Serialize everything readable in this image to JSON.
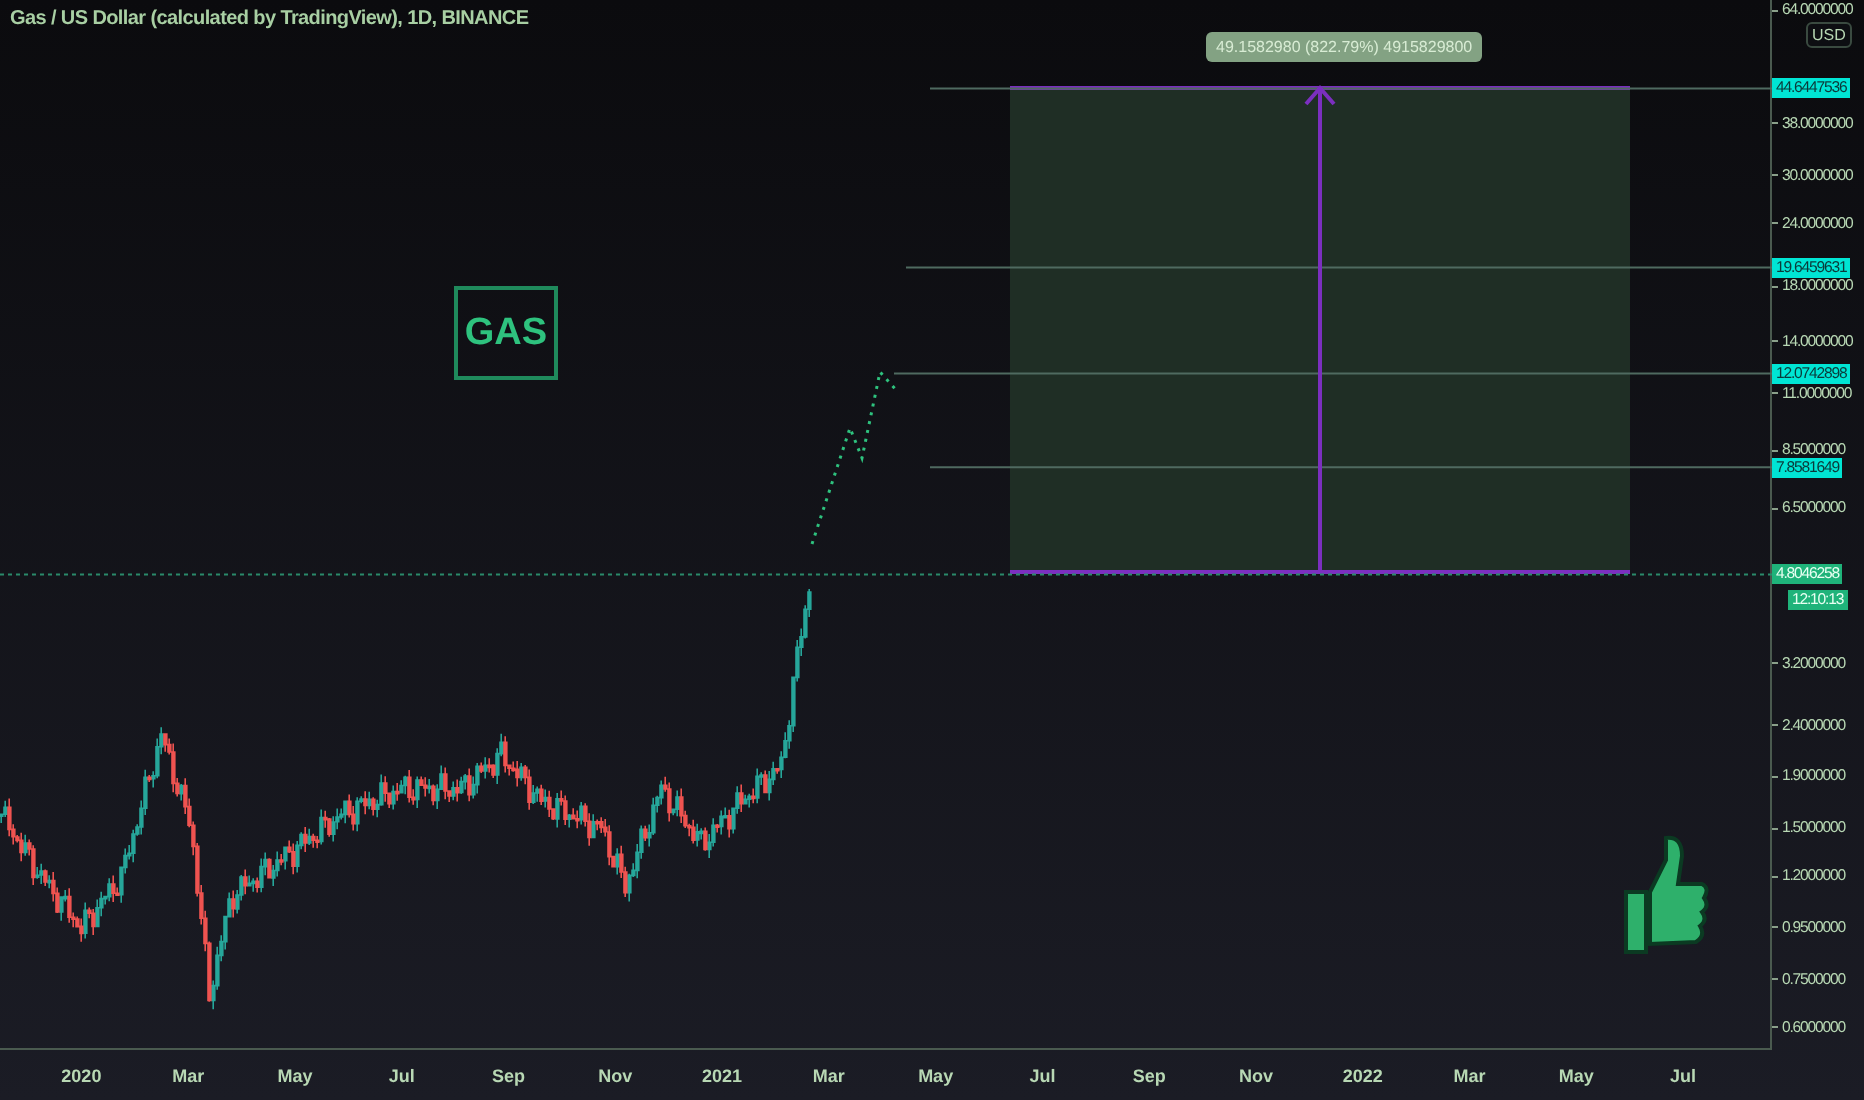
{
  "header": {
    "title": "Gas / US Dollar (calculated by TradingView), 1D, BINANCE"
  },
  "logo": {
    "text": "GAS"
  },
  "measure": {
    "label": "49.1582980 (822.79%) 4915829800"
  },
  "price_axis": {
    "currency": "USD",
    "ticks": [
      "64.0000000",
      "38.0000000",
      "30.0000000",
      "24.0000000",
      "18.0000000",
      "14.0000000",
      "11.0000000",
      "8.5000000",
      "6.5000000",
      "3.2000000",
      "2.4000000",
      "1.9000000",
      "1.5000000",
      "1.2000000",
      "0.9500000",
      "0.7500000",
      "0.6000000"
    ],
    "tags": [
      {
        "text": "44.6447536",
        "kind": "level"
      },
      {
        "text": "19.6459631",
        "kind": "level"
      },
      {
        "text": "12.0742898",
        "kind": "level"
      },
      {
        "text": "7.8581649",
        "kind": "level"
      },
      {
        "text": "4.8046258",
        "kind": "last"
      },
      {
        "text": "12:10:13",
        "kind": "countdown"
      }
    ]
  },
  "time_axis": {
    "ticks": [
      "2020",
      "Mar",
      "May",
      "Jul",
      "Sep",
      "Nov",
      "2021",
      "Mar",
      "May",
      "Jul",
      "Sep",
      "Nov",
      "2022",
      "Mar",
      "May",
      "Jul"
    ]
  }
}
